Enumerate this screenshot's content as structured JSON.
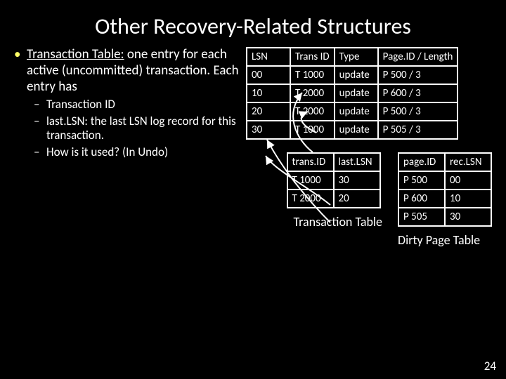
{
  "title": "Other Recovery-Related Structures",
  "bullet": {
    "lead": "Transaction Table:",
    "rest": " one entry for each active (uncommitted) transaction. Each entry has",
    "subs": [
      "Transaction ID",
      "last.LSN: the last LSN log record for this transaction.",
      "How is it used? (In Undo)"
    ]
  },
  "log_table": {
    "headers": [
      "LSN",
      "Trans ID",
      "Type",
      "Page.ID / Length"
    ],
    "rows": [
      [
        "00",
        "T 1000",
        "update",
        "P 500 / 3"
      ],
      [
        "10",
        "T 2000",
        "update",
        "P 600 / 3"
      ],
      [
        "20",
        "T 2000",
        "update",
        "P 500 / 3"
      ],
      [
        "30",
        "T 1000",
        "update",
        "P 505 / 3"
      ]
    ]
  },
  "trans_table": {
    "headers": [
      "trans.ID",
      "last.LSN"
    ],
    "rows": [
      [
        "T 1000",
        "30"
      ],
      [
        "T 2000",
        "20"
      ]
    ],
    "caption": "Transaction Table"
  },
  "dirty_table": {
    "headers": [
      "page.ID",
      "rec.LSN"
    ],
    "rows": [
      [
        "P 500",
        "00"
      ],
      [
        "P 600",
        "10"
      ],
      [
        "P 505",
        "30"
      ]
    ],
    "caption": "Dirty Page Table"
  },
  "page_number": "24",
  "chart_data": {
    "type": "table",
    "tables": [
      {
        "name": "log",
        "columns": [
          "LSN",
          "Trans ID",
          "Type",
          "Page.ID / Length"
        ],
        "rows": [
          [
            "00",
            "T 1000",
            "update",
            "P 500 / 3"
          ],
          [
            "10",
            "T 2000",
            "update",
            "P 600 / 3"
          ],
          [
            "20",
            "T 2000",
            "update",
            "P 500 / 3"
          ],
          [
            "30",
            "T 1000",
            "update",
            "P 505 / 3"
          ]
        ]
      },
      {
        "name": "transaction_table",
        "columns": [
          "trans.ID",
          "last.LSN"
        ],
        "rows": [
          [
            "T 1000",
            "30"
          ],
          [
            "T 2000",
            "20"
          ]
        ]
      },
      {
        "name": "dirty_page_table",
        "columns": [
          "page.ID",
          "rec.LSN"
        ],
        "rows": [
          [
            "P 500",
            "00"
          ],
          [
            "P 600",
            "10"
          ],
          [
            "P 505",
            "30"
          ]
        ]
      }
    ]
  }
}
